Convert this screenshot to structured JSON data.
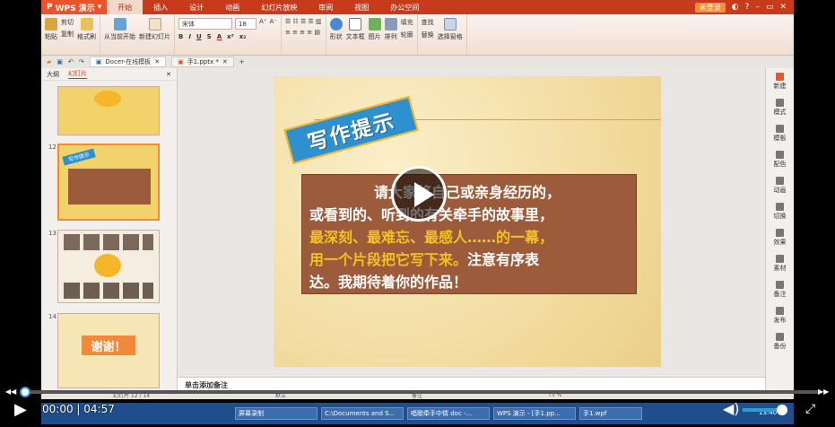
{
  "app": {
    "name": "WPS 演示",
    "tabs": [
      "开始",
      "插入",
      "设计",
      "动画",
      "幻灯片放映",
      "审阅",
      "视图",
      "办公空间"
    ],
    "active_tab": "开始",
    "unregistered": "未登录"
  },
  "ribbon": {
    "paste": "粘贴",
    "cut": "剪切",
    "copy": "复制",
    "format_painter": "格式刷",
    "from_current": "从当前开始",
    "new_slide": "新建幻灯片",
    "font_name": "宋体",
    "font_size": "18",
    "shape": "形状",
    "textbox": "文本框",
    "picture": "图片",
    "arrange": "排列",
    "fill": "填充",
    "outline": "轮廓",
    "find": "查找",
    "replace": "替换",
    "select_pane": "选择窗格"
  },
  "docbar": {
    "tab1": "Docer-在线模板",
    "tab2": "手1.pptx *"
  },
  "leftpanel": {
    "tab_outline": "大纲",
    "tab_slides": "幻灯片",
    "num12": "12",
    "num13": "13",
    "num14": "14",
    "thumb14_text": "谢谢！",
    "thumb12_badge": "写作提示"
  },
  "slide": {
    "badge": "写作提示",
    "line1": "请大家将自己或亲身经历的，",
    "line2": "或看到的、听到的有关牵手的故事里，",
    "line3": "最深刻、最难忘、最感人……的一幕，",
    "line4_hl": "用一个片段把它写下来。",
    "line4_rest": "注意有序表",
    "line5": "达。我期待着你的作品！"
  },
  "notes": {
    "placeholder": "单击添加备注"
  },
  "rightpane": {
    "items": [
      "新建",
      "模式",
      "模板",
      "配色",
      "动画",
      "切换",
      "效果",
      "素材",
      "备注",
      "发布",
      "备份"
    ]
  },
  "statusbar": {
    "slide_count": "幻灯片 12 / 14",
    "theme": "默认",
    "notes": "备注",
    "zoom": "73 %"
  },
  "taskbar": {
    "task1": "屏幕录制",
    "task2": "C:\\Documents and S...",
    "task3": "唱歌牵手中情 doc -...",
    "task4": "WPS 演示 - [手1.pp...",
    "task5": "手1.wpf",
    "clock": "13:40"
  },
  "video": {
    "time_current": "00:00",
    "time_total": "04:57",
    "progress": 0.0,
    "volume": 0.9
  }
}
